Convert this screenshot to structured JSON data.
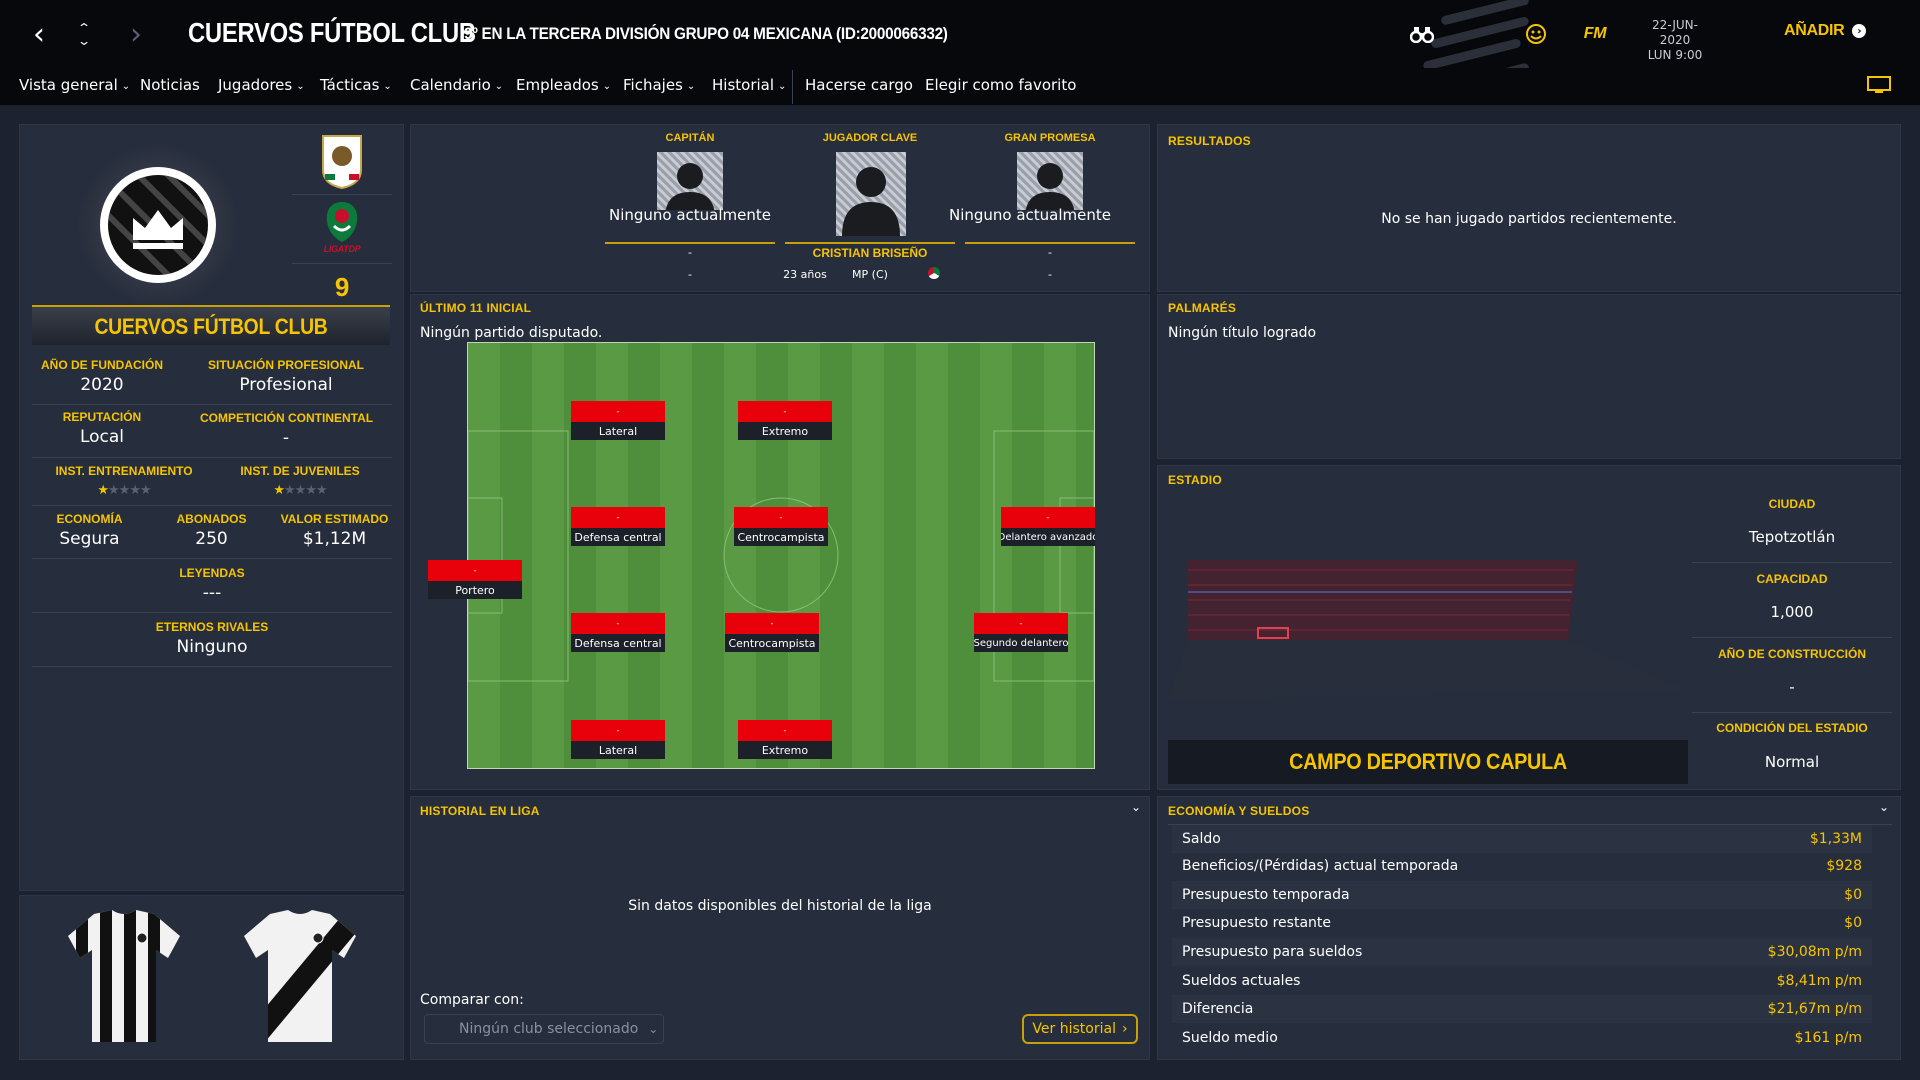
{
  "header": {
    "club_name": "CUERVOS FÚTBOL CLUB",
    "subtitle": "9º EN LA TERCERA DIVISIÓN GRUPO 04 MEXICANA (ID:2000066332)",
    "date": "22-JUN-2020",
    "time": "LUN 9:00",
    "add_label": "AÑADIR",
    "fm_label": "FM"
  },
  "nav": {
    "items": [
      "Vista general",
      "Noticias",
      "Jugadores",
      "Tácticas",
      "Calendario",
      "Empleados",
      "Fichajes",
      "Historial",
      "Hacerse cargo",
      "Elegir como favorito"
    ]
  },
  "club": {
    "name": "CUERVOS FÚTBOL CLUB",
    "position": "9",
    "competition_badge": "LIGATDP",
    "foundation_label": "AÑO DE FUNDACIÓN",
    "foundation": "2020",
    "status_label": "SITUACIÓN PROFESIONAL",
    "status": "Profesional",
    "reputation_label": "REPUTACIÓN",
    "reputation": "Local",
    "continental_label": "COMPETICIÓN CONTINENTAL",
    "continental": "-",
    "training_label": "INST. ENTRENAMIENTO",
    "training_stars": 1,
    "youth_label": "INST. DE JUVENILES",
    "youth_stars": 1,
    "economy_label": "ECONOMÍA",
    "economy": "Segura",
    "members_label": "ABONADOS",
    "members": "250",
    "value_label": "VALOR ESTIMADO",
    "value": "$1,12M",
    "legends_label": "LEYENDAS",
    "legends": "---",
    "rivals_label": "ETERNOS RIVALES",
    "rivals": "Ninguno"
  },
  "key_players": {
    "captain": {
      "label": "CAPITÁN",
      "name": "Ninguno actualmente",
      "dash1": "-",
      "dash2": "-"
    },
    "key": {
      "label": "JUGADOR CLAVE",
      "name": "CRISTIAN BRISEÑO",
      "age": "23 años",
      "pos": "MP (C)"
    },
    "prospect": {
      "label": "GRAN PROMESA",
      "name": "Ninguno actualmente",
      "dash1": "-",
      "dash2": "-"
    }
  },
  "results": {
    "title": "RESULTADOS",
    "empty": "No se han jugado partidos recientemente."
  },
  "lineup": {
    "title": "ÚLTIMO 11 INICIAL",
    "subtitle": "Ningún partido disputado.",
    "players": [
      {
        "pos": "Lateral",
        "num": "-"
      },
      {
        "pos": "Extremo",
        "num": "-"
      },
      {
        "pos": "Defensa central",
        "num": "-"
      },
      {
        "pos": "Centrocampista",
        "num": "-"
      },
      {
        "pos": "Delantero avanzado",
        "num": "-"
      },
      {
        "pos": "Portero",
        "num": "-"
      },
      {
        "pos": "Defensa central",
        "num": "-"
      },
      {
        "pos": "Centrocampista",
        "num": "-"
      },
      {
        "pos": "Segundo delantero",
        "num": "-"
      },
      {
        "pos": "Lateral",
        "num": "-"
      },
      {
        "pos": "Extremo",
        "num": "-"
      }
    ]
  },
  "honours": {
    "title": "PALMARÉS",
    "empty": "Ningún título logrado"
  },
  "stadium": {
    "title": "ESTADIO",
    "name": "CAMPO DEPORTIVO CAPULA",
    "city_label": "CIUDAD",
    "city": "Tepotzotlán",
    "capacity_label": "CAPACIDAD",
    "capacity": "1,000",
    "year_label": "AÑO DE CONSTRUCCIÓN",
    "year": "-",
    "condition_label": "CONDICIÓN DEL ESTADIO",
    "condition": "Normal"
  },
  "league_history": {
    "title": "HISTORIAL EN LIGA",
    "empty": "Sin datos disponibles del historial de la liga",
    "compare_label": "Comparar con:",
    "compare_value": "Ningún club seleccionado",
    "button": "Ver historial"
  },
  "finances": {
    "title": "ECONOMÍA Y SUELDOS",
    "rows": [
      {
        "label": "Saldo",
        "value": "$1,33M"
      },
      {
        "label": "Beneficios/(Pérdidas) actual temporada",
        "value": "$928"
      },
      {
        "label": "Presupuesto temporada",
        "value": "$0"
      },
      {
        "label": "Presupuesto restante",
        "value": "$0"
      },
      {
        "label": "Presupuesto para sueldos",
        "value": "$30,08m p/m"
      },
      {
        "label": "Sueldos actuales",
        "value": "$8,41m p/m"
      },
      {
        "label": "Diferencia",
        "value": "$21,67m p/m"
      },
      {
        "label": "Sueldo medio",
        "value": "$161 p/m"
      }
    ]
  },
  "colors": {
    "accent": "#f6c400",
    "player_red": "#e8000b",
    "pitch_a": "#4f8e3b",
    "pitch_b": "#5a9a45"
  }
}
